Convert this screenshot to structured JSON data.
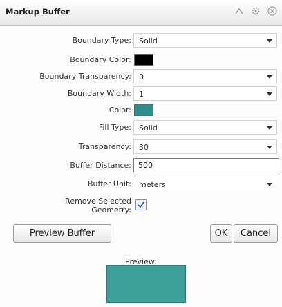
{
  "title": "Markup Buffer",
  "window_icons": [
    "collapse-icon",
    "settings-icon",
    "close-icon"
  ],
  "fields": {
    "boundary_type": {
      "label": "Boundary Type:",
      "value": "Solid"
    },
    "boundary_color": {
      "label": "Boundary Color:",
      "color": "#000000"
    },
    "boundary_transparency": {
      "label": "Boundary Transparency:",
      "value": "0"
    },
    "boundary_width": {
      "label": "Boundary Width:",
      "value": "1"
    },
    "color": {
      "label": "Color:",
      "color": "#2f8f88"
    },
    "fill_type": {
      "label": "Fill Type:",
      "value": "Solid"
    },
    "transparency": {
      "label": "Transparency:",
      "value": "30"
    },
    "buffer_distance": {
      "label": "Buffer Distance:",
      "value": "500"
    },
    "buffer_unit": {
      "label": "Buffer Unit:",
      "value": "meters"
    },
    "remove_selected": {
      "label": "Remove Selected Geometry:",
      "checked": true
    }
  },
  "buttons": {
    "preview": "Preview Buffer",
    "ok": "OK",
    "cancel": "Cancel"
  },
  "preview": {
    "label": "Preview:",
    "fill_color": "#3e9f98"
  }
}
